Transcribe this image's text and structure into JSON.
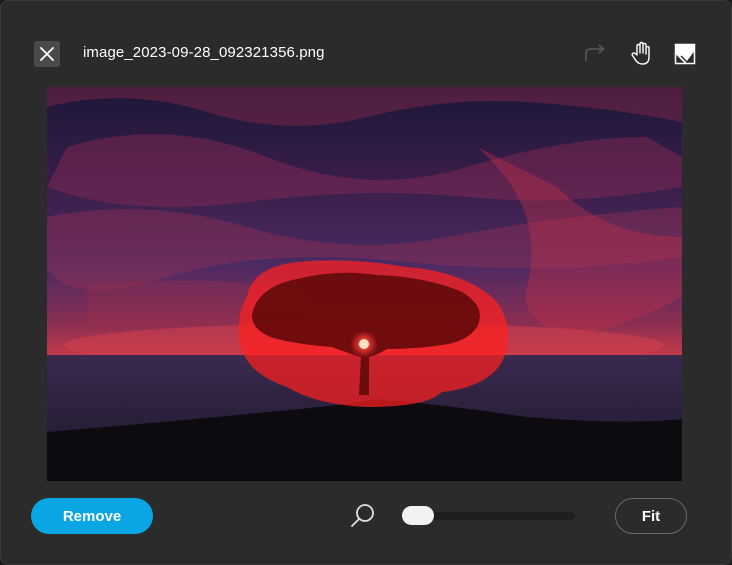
{
  "header": {
    "filename": "image_2023-09-28_092321356.png"
  },
  "icons": {
    "close": "close-icon",
    "redo": "redo-icon",
    "pan": "hand-icon",
    "eraser": "eraser-icon",
    "zoom": "search-icon"
  },
  "footer": {
    "remove_label": "Remove",
    "fit_label": "Fit",
    "zoom_fraction": 0.0
  },
  "colors": {
    "accent": "#0aa6e3",
    "mask": "#ff2020",
    "background": "#2b2b2b"
  }
}
